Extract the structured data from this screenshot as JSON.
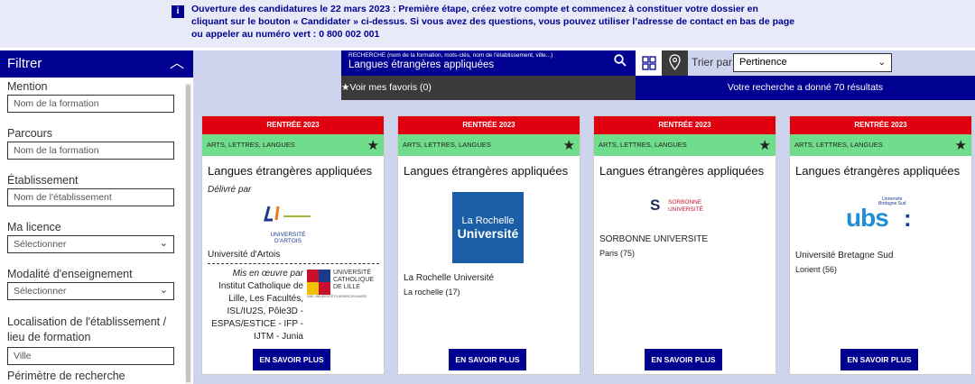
{
  "banner": {
    "text": "Ouverture des candidatures le 22 mars 2023 : Première étape, créez votre compte et commencez à constituer votre dossier en cliquant sur le bouton « Candidater » ci-dessus. Si vous avez des questions, vous pouvez utiliser l’adresse de contact en bas de page ou appeler au numéro vert : 0 800 002 001"
  },
  "sidebar": {
    "title": "Filtrer",
    "filters": [
      {
        "label": "Mention",
        "placeholder": "Nom de la formation"
      },
      {
        "label": "Parcours",
        "placeholder": "Nom de la formation"
      },
      {
        "label": "Établissement",
        "placeholder": "Nom de l'établissement"
      },
      {
        "label": "Ma licence",
        "placeholder": "Sélectionner"
      },
      {
        "label": "Modalité d'enseignement",
        "placeholder": "Sélectionner"
      },
      {
        "label": "Localisation de l'établissement / lieu de formation",
        "placeholder": "Ville"
      },
      {
        "label": "Périmètre de recherche"
      }
    ]
  },
  "search": {
    "label": "RECHERCHE (nom de la formation, mots-clés, nom de l'établissement, ville...)",
    "value": "Langues étrangères appliquées",
    "favorites": "Voir mes favoris (0)",
    "sort_label": "Trier par",
    "sort_value": "Pertinence",
    "results": "Votre recherche a donné 70 résultats"
  },
  "cards": [
    {
      "rentree": "RENTRÉE 2023",
      "domain": "ARTS, LETTRES, LANGUES",
      "title": "Langues étrangères appliquées",
      "delivered": "Délivré par",
      "logo_text": "UNIVERSITÉ D'ARTOIS",
      "univ": "Université d'Artois",
      "mis": "Mis en œuvre par",
      "partner": "Institut Catholique de Lille, Les Facultés, ISL/IU2S, Pôle3D - ESPAS/ESTICE - IFP - IJTM - Junia",
      "partner_logo": "UNIVERSITÉ CATHOLIQUE DE LILLE",
      "partner_logo_sub": "UNE UNIVERSITÉ PLURIDISCIPLINAIRE",
      "partner_year": "1875",
      "btn": "EN SAVOIR PLUS"
    },
    {
      "rentree": "RENTRÉE 2023",
      "domain": "ARTS, LETTRES, LANGUES",
      "title": "Langues étrangères appliquées",
      "logo_l1": "La Rochelle",
      "logo_l2": "Université",
      "univ": "La Rochelle Université",
      "city": "La rochelle (17)",
      "btn": "EN SAVOIR PLUS"
    },
    {
      "rentree": "RENTRÉE 2023",
      "domain": "ARTS, LETTRES, LANGUES",
      "title": "Langues étrangères appliquées",
      "logo_l1": "SORBONNE",
      "logo_l2": "UNIVERSITÉ",
      "univ": "SORBONNE UNIVERSITE",
      "city": "Paris (75)",
      "btn": "EN SAVOIR PLUS"
    },
    {
      "rentree": "RENTRÉE 2023",
      "domain": "ARTS, LETTRES, LANGUES",
      "title": "Langues étrangères appliquées",
      "logo_l1": "Université",
      "logo_l2": "Bretagne Sud",
      "logo_main": "ubs",
      "univ": "Université Bretagne Sud",
      "city": "Lorient (56)",
      "btn": "EN SAVOIR PLUS"
    }
  ],
  "colors": {
    "navy": "#000091",
    "red": "#e1000f",
    "green": "#6fdd8b",
    "bg": "#cfd4ee"
  }
}
